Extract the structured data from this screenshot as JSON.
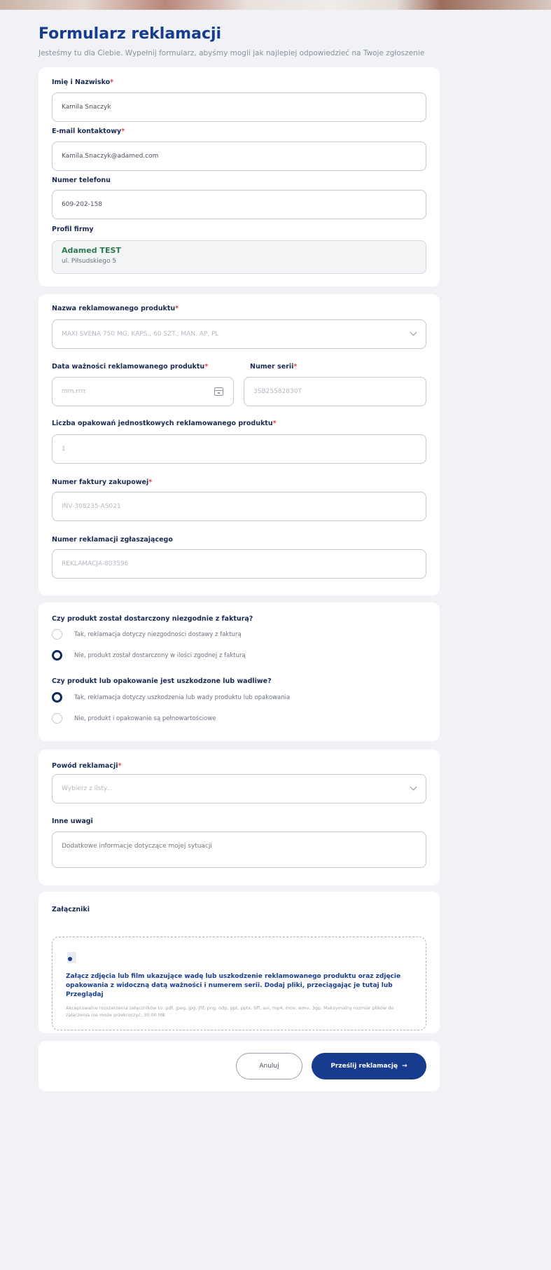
{
  "page": {
    "title": "Formularz reklamacji",
    "subtitle": "Jesteśmy tu dla Ciebie. Wypełnij formularz, abyśmy mogli jak najlepiej odpowiedzieć na Twoje zgłoszenie"
  },
  "contact": {
    "name_label": "Imię i Nazwisko",
    "name_value": "Kamila Snaczyk",
    "email_label": "E-mail kontaktowy",
    "email_value": "Kamila.Snaczyk@adamed.com",
    "phone_label": "Numer telefonu",
    "phone_value": "609-202-158",
    "profile_label": "Profil firmy",
    "profile_name": "Adamed TEST",
    "profile_address": "ul. Piłsudskiego 5"
  },
  "product": {
    "name_label": "Nazwa reklamowanego produktu",
    "name_value": "MAXI SVENA 750 MG, KAPS., 60 SZT.; MAN. AP, PL",
    "expiry_label": "Data ważności reklamowanego produktu",
    "expiry_placeholder": "mm.rrrr",
    "serial_label": "Numer serii",
    "serial_value": "3SB25582830T",
    "qty_label": "Liczba opakowań jednostkowych reklamowanego produktu",
    "qty_value": "1",
    "invoice_label": "Numer faktury zakupowej",
    "invoice_value": "INV-308235-AS021",
    "complaint_no_label": "Numer reklamacji zgłaszającego",
    "complaint_no_value": "REKLAMACJA-803596"
  },
  "questions": {
    "q1": "Czy produkt został dostarczony niezgodnie z fakturą?",
    "q1_opt1": "Tak, reklamacja dotyczy niezgodności dostawy z fakturą",
    "q1_opt2": "Nie, produkt został dostarczony w ilości zgodnej z fakturą",
    "q2": "Czy produkt lub opakowanie jest uszkodzone lub wadliwe?",
    "q2_opt1": "Tak, reklamacja dotyczy uszkodzenia lub wady produktu lub opakowania",
    "q2_opt2": "Nie, produkt i opakowanie są pełnowartościowe"
  },
  "reason": {
    "label": "Powód reklamacji",
    "placeholder": "Wybierz z listy...",
    "notes_label": "Inne uwagi",
    "notes_placeholder": "Dodatkowe informacje dotyczące mojej sytuacji"
  },
  "attachments": {
    "label": "Załączniki",
    "main": "Załącz zdjęcia lub film ukazujące wadę lub uszkodzenie reklamowanego produktu oraz zdjęcie opakowania z widoczną datą ważności i numerem serii. Dodaj pliki, przeciągając je tutaj lub Przeglądaj",
    "note": "Akceptowalne rozszerzenia załączników to: pdf, jpeg, jpg, jfif, png, odp, ppt, pptx, tiff, avi, mp4, mov, wmv, 3gp. Maksymalny rozmiar plików do załączenia nie może przekroczyć: 30.00 MB"
  },
  "actions": {
    "cancel": "Anuluj",
    "submit": "Prześlij reklamację",
    "submit_arrow": "→"
  },
  "required_mark": "*"
}
